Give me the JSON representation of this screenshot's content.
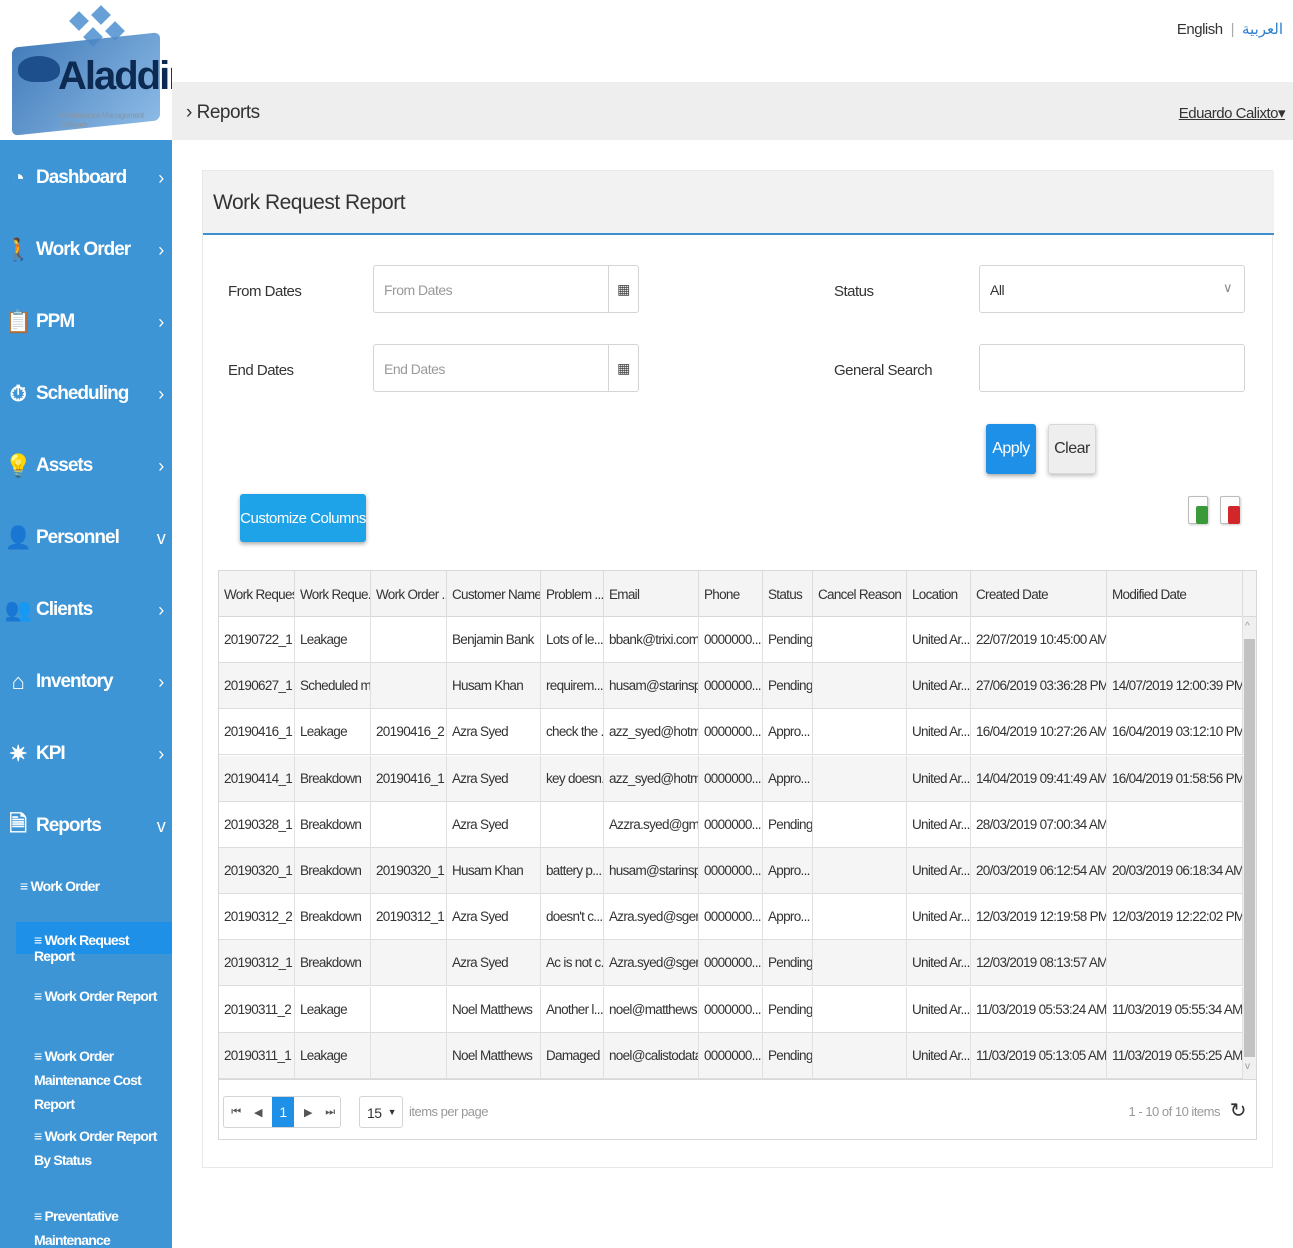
{
  "app": {
    "logo_text": "Aladdin",
    "logo_subtitle": "Maintenance Management Software"
  },
  "lang": {
    "english": "English",
    "arabic": "العربية"
  },
  "breadcrumb": {
    "page": "Reports",
    "user": "Eduardo Calixto"
  },
  "sidebar": {
    "items": [
      {
        "label": "Dashboard",
        "icon": "dashboard-icon",
        "chevron": "›"
      },
      {
        "label": "Work Order",
        "icon": "walking-person-icon",
        "chevron": "›"
      },
      {
        "label": "PPM",
        "icon": "clipboard-icon",
        "chevron": "›"
      },
      {
        "label": "Scheduling",
        "icon": "clock-icon",
        "chevron": "›"
      },
      {
        "label": "Assets",
        "icon": "lightbulb-icon",
        "chevron": "›"
      },
      {
        "label": "Personnel",
        "icon": "person-icon",
        "chevron": "v"
      },
      {
        "label": "Clients",
        "icon": "group-icon",
        "chevron": "›"
      },
      {
        "label": "Inventory",
        "icon": "home-icon",
        "chevron": "›"
      },
      {
        "label": "KPI",
        "icon": "gear-icon",
        "chevron": "›"
      },
      {
        "label": "Reports",
        "icon": "report-icon",
        "chevron": "v"
      }
    ],
    "sub_header": "Work Order",
    "sub_items": [
      {
        "label": "Work Request Report"
      },
      {
        "label": "Work Order Report"
      },
      {
        "label": "Work Order Maintenance Cost Report"
      },
      {
        "label": "Work Order Report By Status"
      },
      {
        "label": "Preventative Maintenance Instruction Report"
      }
    ]
  },
  "panel": {
    "title": "Work Request Report"
  },
  "filters": {
    "from_label": "From Dates",
    "from_placeholder": "From Dates",
    "end_label": "End Dates",
    "end_placeholder": "End Dates",
    "status_label": "Status",
    "status_value": "All",
    "search_label": "General Search",
    "search_value": ""
  },
  "buttons": {
    "apply": "Apply",
    "clear": "Clear",
    "customize": "Customize Columns"
  },
  "grid": {
    "columns": [
      "Work Request",
      "Work Reque...",
      "Work Order ...",
      "Customer Name",
      "Problem ...",
      "Email",
      "Phone",
      "Status",
      "Cancel Reason",
      "Location",
      "Created Date",
      "Modified Date"
    ],
    "rows": [
      [
        "20190722_1",
        "Leakage",
        "",
        "Benjamin Bank",
        "Lots of le...",
        "bbank@trixi.com...",
        "0000000...",
        "Pending",
        "",
        "United Ar...",
        "22/07/2019 10:45:00 AM",
        ""
      ],
      [
        "20190627_1",
        "Scheduled m...",
        "",
        "Husam Khan",
        "requirem...",
        "husam@starinsp...",
        "0000000...",
        "Pending",
        "",
        "United Ar...",
        "27/06/2019 03:36:28 PM",
        "14/07/2019 12:00:39 PM"
      ],
      [
        "20190416_1",
        "Leakage",
        "20190416_2",
        "Azra Syed",
        "check the ...",
        "azz_syed@hotma...",
        "0000000...",
        "Appro...",
        "",
        "United Ar...",
        "16/04/2019 10:27:26 AM",
        "16/04/2019 03:12:10 PM"
      ],
      [
        "20190414_1",
        "Breakdown",
        "20190416_1",
        "Azra Syed",
        "key doesn...",
        "azz_syed@hotma...",
        "0000000...",
        "Appro...",
        "",
        "United Ar...",
        "14/04/2019 09:41:49 AM",
        "16/04/2019 01:58:56 PM"
      ],
      [
        "20190328_1",
        "Breakdown",
        "",
        "Azra Syed",
        "",
        "Azzra.syed@gma...",
        "0000000...",
        "Pending",
        "",
        "United Ar...",
        "28/03/2019 07:00:34 AM",
        ""
      ],
      [
        "20190320_1",
        "Breakdown",
        "20190320_1",
        "Husam Khan",
        "battery p...",
        "husam@starinsp...",
        "0000000...",
        "Appro...",
        "",
        "United Ar...",
        "20/03/2019 06:12:54 AM",
        "20/03/2019 06:18:34 AM"
      ],
      [
        "20190312_2",
        "Breakdown",
        "20190312_1",
        "Azra Syed",
        "doesn't c...",
        "Azra.syed@sgem...",
        "0000000...",
        "Appro...",
        "",
        "United Ar...",
        "12/03/2019 12:19:58 PM",
        "12/03/2019 12:22:02 PM"
      ],
      [
        "20190312_1",
        "Breakdown",
        "",
        "Azra Syed",
        "Ac is not c...",
        "Azra.syed@sgem...",
        "0000000...",
        "Pending",
        "",
        "United Ar...",
        "12/03/2019 08:13:57 AM",
        ""
      ],
      [
        "20190311_2",
        "Leakage",
        "",
        "Noel Matthews",
        "Another l...",
        "noel@matthews....",
        "0000000...",
        "Pending",
        "",
        "United Ar...",
        "11/03/2019 05:53:24 AM",
        "11/03/2019 05:55:34 AM"
      ],
      [
        "20190311_1",
        "Leakage",
        "",
        "Noel Matthews",
        "Damaged ...",
        "noel@calistodata...",
        "0000000...",
        "Pending",
        "",
        "United Ar...",
        "11/03/2019 05:13:05 AM",
        "11/03/2019 05:55:25 AM"
      ]
    ]
  },
  "pager": {
    "current_page": "1",
    "page_size": "15",
    "items_per_page": "items per page",
    "info": "1 - 10 of 10 items"
  },
  "colors": {
    "sidebar": "#3e95d5",
    "accent": "#1e90e8",
    "active_sub": "#1e90e8"
  }
}
